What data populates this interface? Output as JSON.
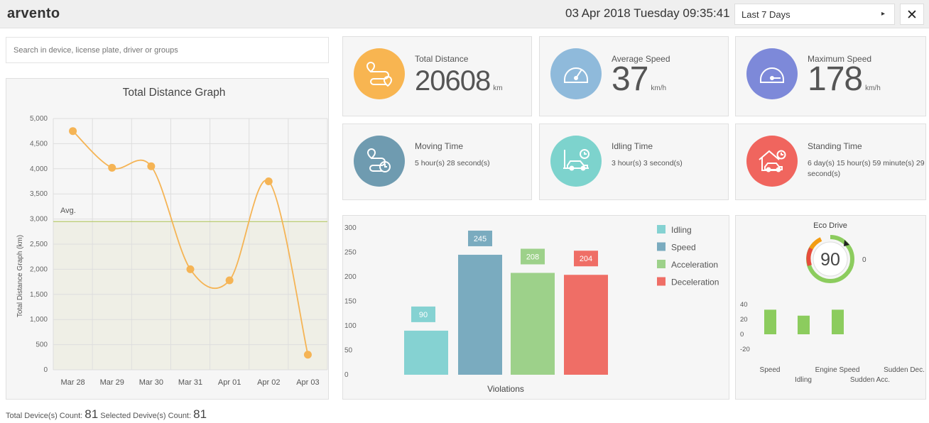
{
  "header": {
    "logo": "arvento",
    "datetime": "03 Apr 2018 Tuesday 09:35:41",
    "range_selected": "Last 7 Days",
    "close_glyph": "✕"
  },
  "search": {
    "placeholder": "Search in device, license plate, driver or groups"
  },
  "distance_chart": {
    "chart_data": {
      "type": "line",
      "title": "Total Distance Graph",
      "ylabel": "Total Distance Graph (km)",
      "xlabel": "",
      "categories": [
        "Mar 28",
        "Mar 29",
        "Mar 30",
        "Mar 31",
        "Apr 01",
        "Apr 02",
        "Apr 03"
      ],
      "series": [
        {
          "values": [
            4750,
            4020,
            4050,
            2000,
            1780,
            3750,
            300
          ]
        }
      ],
      "yticks": [
        "5,000",
        "4,500",
        "4,000",
        "3,500",
        "3,000",
        "2,500",
        "2,000",
        "1,500",
        "1,000",
        "500",
        "0"
      ],
      "ylim": [
        0,
        5000
      ],
      "avg_value": 2950,
      "avg_label": "Avg.",
      "grid": true,
      "line_color": "#f5b455",
      "avg_color": "#b5c96a"
    }
  },
  "cards": [
    {
      "title": "Total Distance",
      "value": "20608",
      "unit": "km",
      "icon": "route-icon",
      "color": "#f8b551"
    },
    {
      "title": "Average Speed",
      "value": "37",
      "unit": "km/h",
      "icon": "speedometer-icon",
      "color": "#8fbadb"
    },
    {
      "title": "Maximum Speed",
      "value": "178",
      "unit": "km/h",
      "icon": "max-speedometer-icon",
      "color": "#7d89d9"
    },
    {
      "title": "Moving Time",
      "text": "5 hour(s) 28 second(s)",
      "icon": "moving-route-icon",
      "color": "#6f9bb0"
    },
    {
      "title": "Idling Time",
      "text": "3 hour(s) 3 second(s)",
      "icon": "idling-car-icon",
      "color": "#7dd3cd"
    },
    {
      "title": "Standing Time",
      "text": "6 day(s) 15 hour(s) 59 minute(s) 29 second(s)",
      "icon": "standing-car-icon",
      "color": "#f0655e"
    }
  ],
  "violations_chart": {
    "chart_data": {
      "type": "bar",
      "xlabel": "Violations",
      "categories": [
        "Idling",
        "Speed",
        "Acceleration",
        "Deceleration"
      ],
      "values": [
        90,
        245,
        208,
        204
      ],
      "colors": [
        "#85d2d2",
        "#7aabbf",
        "#9dd18a",
        "#ef6e66"
      ],
      "yticks": [
        "300",
        "250",
        "200",
        "150",
        "100",
        "50",
        "0"
      ],
      "ylim": [
        0,
        300
      ],
      "legend": [
        "Idling",
        "Speed",
        "Acceleration",
        "Deceleration"
      ],
      "legend_position": "top-right"
    }
  },
  "eco_drive": {
    "title": "Eco Drive",
    "score": "90",
    "side_value": "0",
    "chart_data": {
      "type": "bar",
      "categories": [
        "Speed",
        "Idling",
        "Engine Speed",
        "Sudden Acc.",
        "Sudden Dec."
      ],
      "values": [
        33,
        25,
        33,
        0,
        0
      ],
      "yticks": [
        "40",
        "20",
        "0",
        "-20"
      ],
      "ylim": [
        -20,
        40
      ],
      "color": "#8ccc5e"
    }
  },
  "footer": {
    "total_label": "Total Device(s) Count:",
    "total_value": "81",
    "selected_label": "Selected Devive(s) Count:",
    "selected_value": "81"
  }
}
